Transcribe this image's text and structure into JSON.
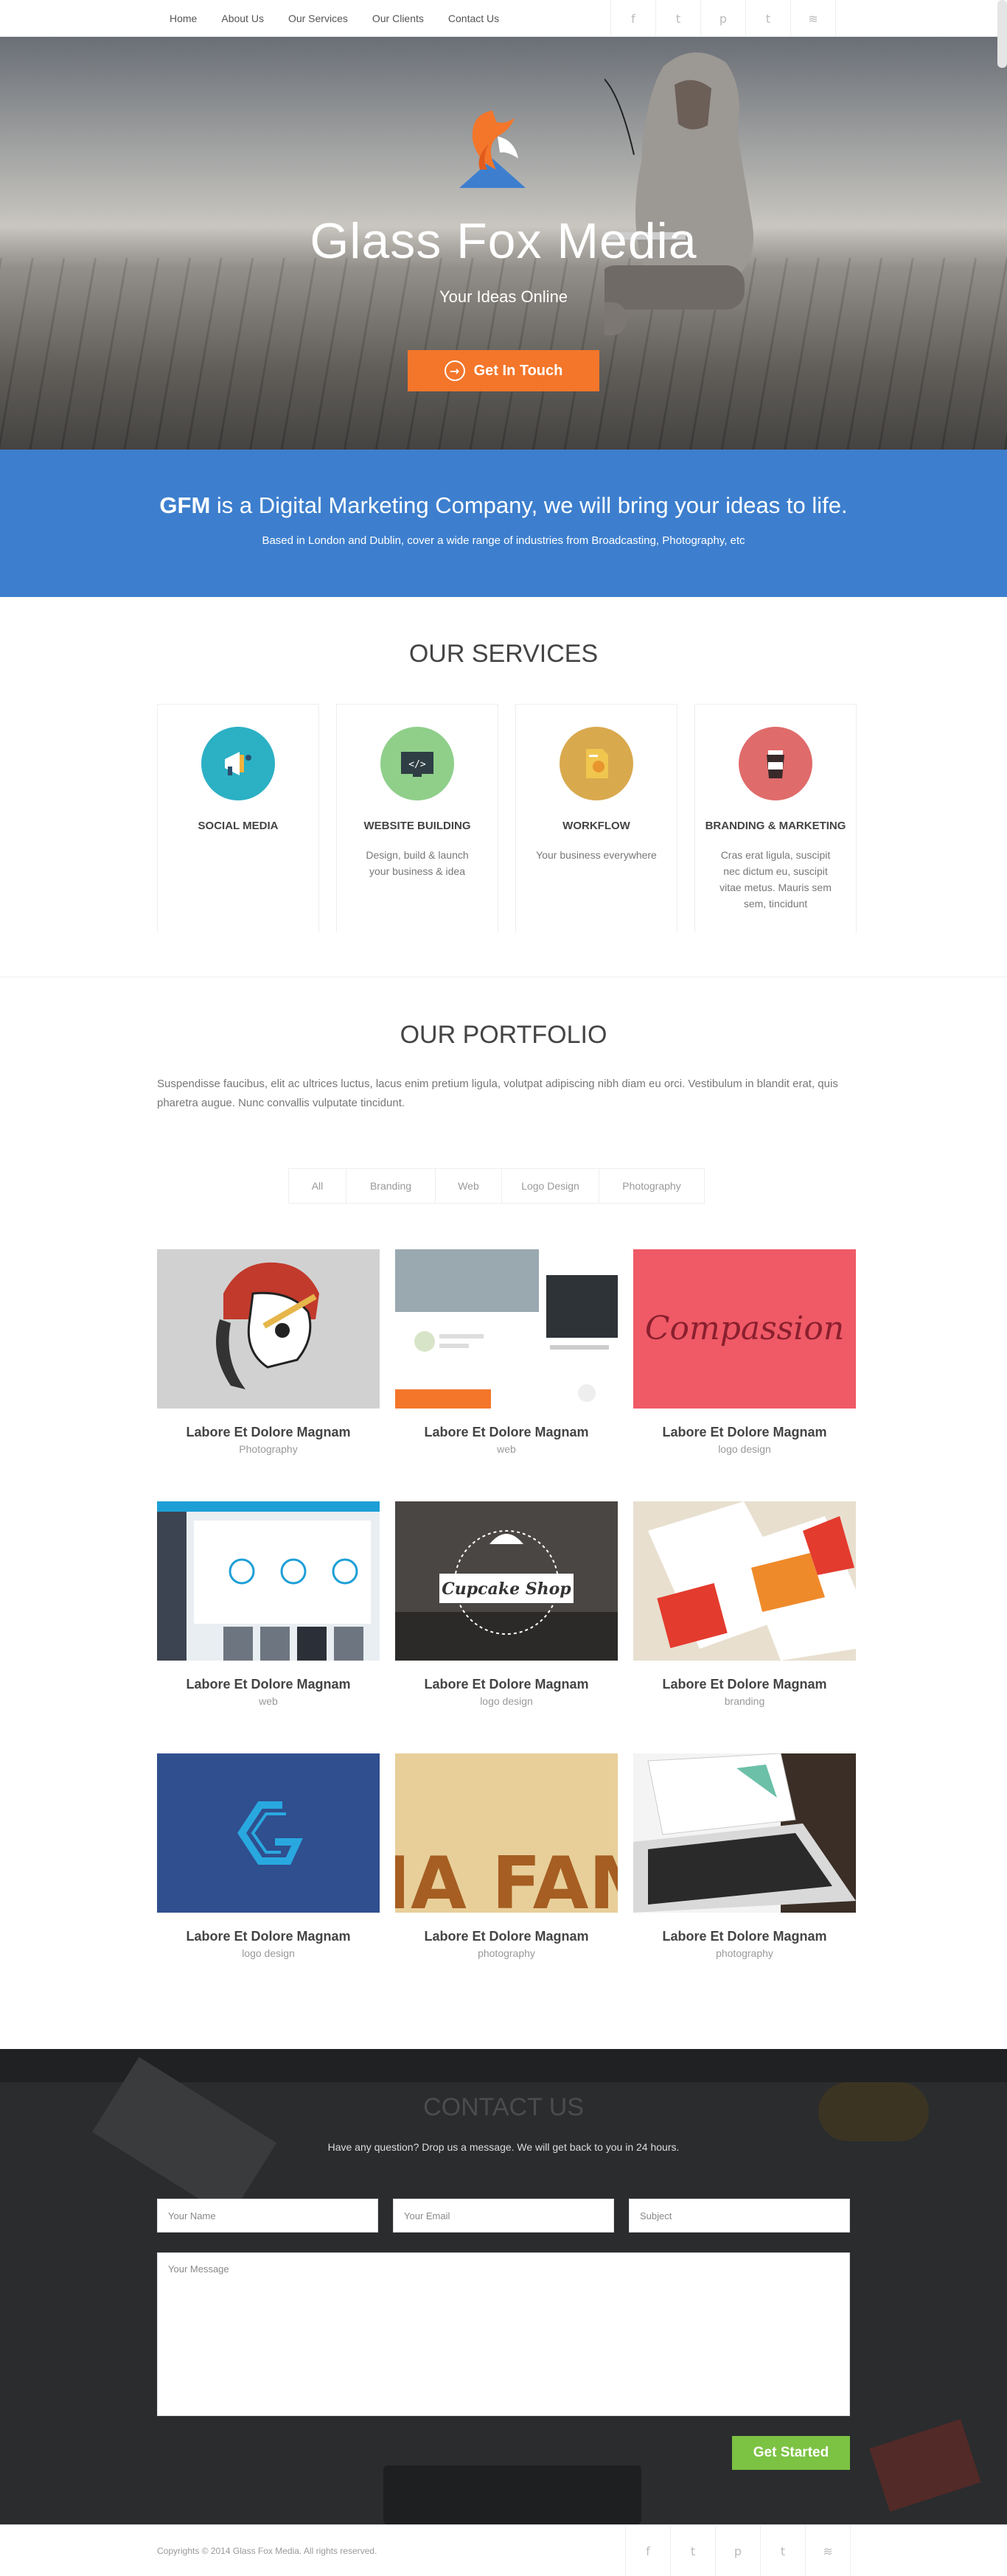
{
  "nav": {
    "items": [
      "Home",
      "About Us",
      "Our Services",
      "Our Clients",
      "Contact Us"
    ],
    "social": [
      {
        "icon": "facebook-icon",
        "glyph": "f"
      },
      {
        "icon": "twitter-icon",
        "glyph": "t"
      },
      {
        "icon": "pinterest-icon",
        "glyph": "p"
      },
      {
        "icon": "twitter-icon",
        "glyph": "t"
      },
      {
        "icon": "rss-icon",
        "glyph": "≋"
      }
    ]
  },
  "hero": {
    "title": "Glass Fox Media",
    "tagline": "Your Ideas Online",
    "cta": "Get In Touch"
  },
  "intro": {
    "brand": "GFM",
    "lead": " is a Digital Marketing Company, we will bring your ideas to life.",
    "sub": "Based in London and Dublin, cover a wide range of industries from Broadcasting, Photography, etc"
  },
  "services": {
    "title": "OUR SERVICES",
    "cards": [
      {
        "title": "SOCIAL MEDIA",
        "text": "",
        "color": "#2bb0c4",
        "icon": "megaphone-icon"
      },
      {
        "title": "WEBSITE BUILDING",
        "text": "Design, build & launch your business & idea",
        "color": "#8fcf8a",
        "icon": "code-screen-icon"
      },
      {
        "title": "WORKFLOW",
        "text": "Your business everywhere",
        "color": "#d9a94e",
        "icon": "document-chart-icon"
      },
      {
        "title": "BRANDING & MARKETING",
        "text": "Cras erat ligula, suscipit nec dictum eu, suscipit vitae metus. Mauris sem sem, tincidunt",
        "color": "#e06b6b",
        "icon": "coffee-cup-icon"
      }
    ]
  },
  "portfolio": {
    "title": "OUR PORTFOLIO",
    "description": "Suspendisse faucibus, elit ac ultrices luctus, lacus enim pretium ligula, volutpat adipiscing nibh diam eu orci. Vestibulum in blandit erat, quis pharetra augue. Nunc convallis vulputate tincidunt.",
    "filters": [
      "All",
      "Branding",
      "Web",
      "Logo Design",
      "Photography"
    ],
    "items": [
      {
        "title": "Labore Et Dolore Magnam",
        "category": "Photography",
        "art": "chief-skull"
      },
      {
        "title": "Labore Et Dolore Magnam",
        "category": "web",
        "art": "web-layout"
      },
      {
        "title": "Labore Et Dolore Magnam",
        "category": "logo design",
        "art": "compass-script",
        "text": "Compassion"
      },
      {
        "title": "Labore Et Dolore Magnam",
        "category": "web",
        "art": "dashboard"
      },
      {
        "title": "Labore Et Dolore Magnam",
        "category": "logo design",
        "art": "cupcake-badge",
        "text": "Cupcake Shop"
      },
      {
        "title": "Labore Et Dolore Magnam",
        "category": "branding",
        "art": "stationery"
      },
      {
        "title": "Labore Et Dolore Magnam",
        "category": "logo design",
        "art": "g-logo"
      },
      {
        "title": "Labore Et Dolore Magnam",
        "category": "photography",
        "art": "typography",
        "text": "MA FAMI"
      },
      {
        "title": "Labore Et Dolore Magnam",
        "category": "photography",
        "art": "laptop"
      }
    ]
  },
  "contact": {
    "title": "CONTACT US",
    "message": "Have any question? Drop us a message. We will get back to you in 24 hours.",
    "name_placeholder": "Your Name",
    "email_placeholder": "Your Email",
    "subject_placeholder": "Subject",
    "message_placeholder": "Your Message",
    "submit": "Get Started"
  },
  "footer": {
    "copyright": "Copyrights © 2014 Glass Fox Media. All rights reserved."
  }
}
